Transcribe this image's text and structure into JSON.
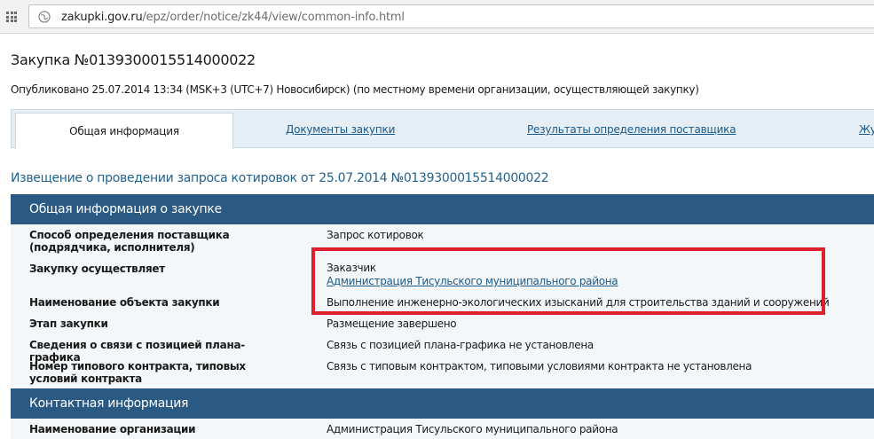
{
  "browser": {
    "url_host": "zakupki.gov.ru",
    "url_path": "/epz/order/notice/zk44/view/common-info.html"
  },
  "header": {
    "title": "Закупка №0139300015514000022",
    "published": "Опубликовано 25.07.2014 13:34 (MSK+3 (UTC+7) Новосибирск) (по местному времени организации, осуществляющей закупку)"
  },
  "tabs": [
    {
      "label": "Общая информация"
    },
    {
      "label": "Документы закупки"
    },
    {
      "label": "Результаты определения поставщика"
    },
    {
      "label": "Жу"
    }
  ],
  "notice_title": "Извещение о проведении запроса котировок от 25.07.2014 №0139300015514000022",
  "general": {
    "header": "Общая информация о закупке",
    "rows": [
      {
        "label": "Способ определения поставщика (подрядчика, исполнителя)",
        "value": "Запрос котировок"
      },
      {
        "label": "Закупку осуществляет",
        "value": "Заказчик",
        "link": "Администрация Тисульского муниципального района"
      },
      {
        "label": "Наименование объекта закупки",
        "value": "Выполнение инженерно-экологических изысканий для строительства зданий и сооружений"
      },
      {
        "label": "Этап закупки",
        "value": "Размещение завершено"
      },
      {
        "label": "Сведения о связи с позицией плана-графика",
        "value": "Связь с позицией плана-графика не установлена"
      },
      {
        "label": "Номер типового контракта, типовых условий контракта",
        "value": "Связь с типовым контрактом, типовыми условиями контракта не установлена"
      }
    ]
  },
  "contact": {
    "header": "Контактная информация",
    "rows": [
      {
        "label": "Наименование организации",
        "value": "Администрация Тисульского муниципального района"
      }
    ]
  },
  "colors": {
    "section_header": "#2a5983",
    "link": "#1b5a8a",
    "highlight": "#e0202d"
  },
  "icons": [
    "apps-grid-icon",
    "globe-icon"
  ]
}
